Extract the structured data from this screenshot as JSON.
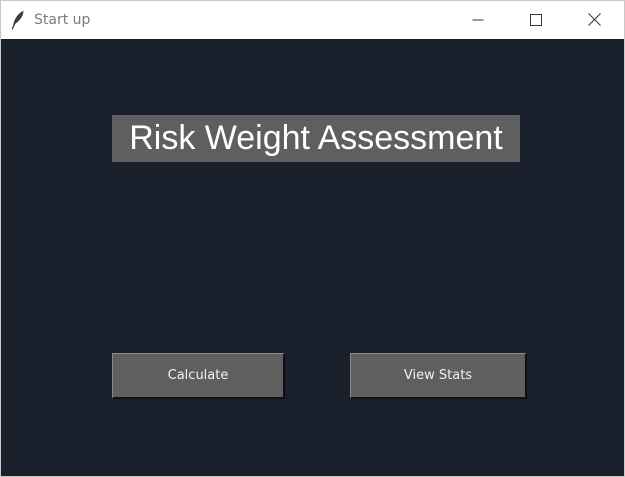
{
  "window": {
    "title": "Start up",
    "icon": "feather-icon",
    "controls": [
      "minimize-icon",
      "maximize-icon",
      "close-icon"
    ]
  },
  "main": {
    "heading": "Risk Weight Assessment",
    "buttons": {
      "calculate_label": "Calculate",
      "view_stats_label": "View Stats"
    }
  },
  "colors": {
    "background": "#1a202b",
    "heading_bg": "#5f5f5f",
    "button_bg": "#5f5f5f",
    "text": "#ffffff"
  }
}
